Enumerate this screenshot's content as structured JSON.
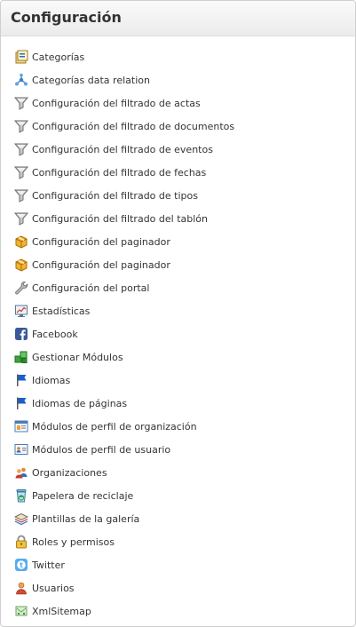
{
  "panel": {
    "title": "Configuración"
  },
  "items": [
    {
      "label": "Categorías",
      "icon": "categories-icon"
    },
    {
      "label": "Categorías data relation",
      "icon": "network-icon"
    },
    {
      "label": "Configuración del filtrado de actas",
      "icon": "funnel-icon"
    },
    {
      "label": "Configuración del filtrado de documentos",
      "icon": "funnel-icon"
    },
    {
      "label": "Configuración del filtrado de eventos",
      "icon": "funnel-icon"
    },
    {
      "label": "Configuración del filtrado de fechas",
      "icon": "funnel-icon"
    },
    {
      "label": "Configuración del filtrado de tipos",
      "icon": "funnel-icon"
    },
    {
      "label": "Configuración del filtrado del tablón",
      "icon": "funnel-icon"
    },
    {
      "label": "Configuración del paginador",
      "icon": "package-icon"
    },
    {
      "label": "Configuración del paginador",
      "icon": "package-icon"
    },
    {
      "label": "Configuración del portal",
      "icon": "wrench-icon"
    },
    {
      "label": "Estadísticas",
      "icon": "chart-icon"
    },
    {
      "label": "Facebook",
      "icon": "facebook-icon"
    },
    {
      "label": "Gestionar Módulos",
      "icon": "modules-icon"
    },
    {
      "label": "Idiomas",
      "icon": "flag-icon"
    },
    {
      "label": "Idiomas de páginas",
      "icon": "flag-icon"
    },
    {
      "label": "Módulos de perfil de organización",
      "icon": "profile-window-icon"
    },
    {
      "label": "Módulos de perfil de usuario",
      "icon": "profile-card-icon"
    },
    {
      "label": "Organizaciones",
      "icon": "group-icon"
    },
    {
      "label": "Papelera de reciclaje",
      "icon": "recycle-bin-icon"
    },
    {
      "label": "Plantillas de la galería",
      "icon": "gallery-icon"
    },
    {
      "label": "Roles y permisos",
      "icon": "lock-icon"
    },
    {
      "label": "Twitter",
      "icon": "twitter-icon"
    },
    {
      "label": "Usuarios",
      "icon": "user-icon"
    },
    {
      "label": "XmlSitemap",
      "icon": "sitemap-icon"
    }
  ],
  "colors": {
    "text": "#333333",
    "header_bg": "#ebebeb",
    "border": "#cfcfcf",
    "facebook": "#3b5998",
    "twitter": "#55acee",
    "flag": "#1c5fc8",
    "funnel": "#8c8c8c",
    "package": "#e8a317",
    "modules": "#3aa53a"
  }
}
